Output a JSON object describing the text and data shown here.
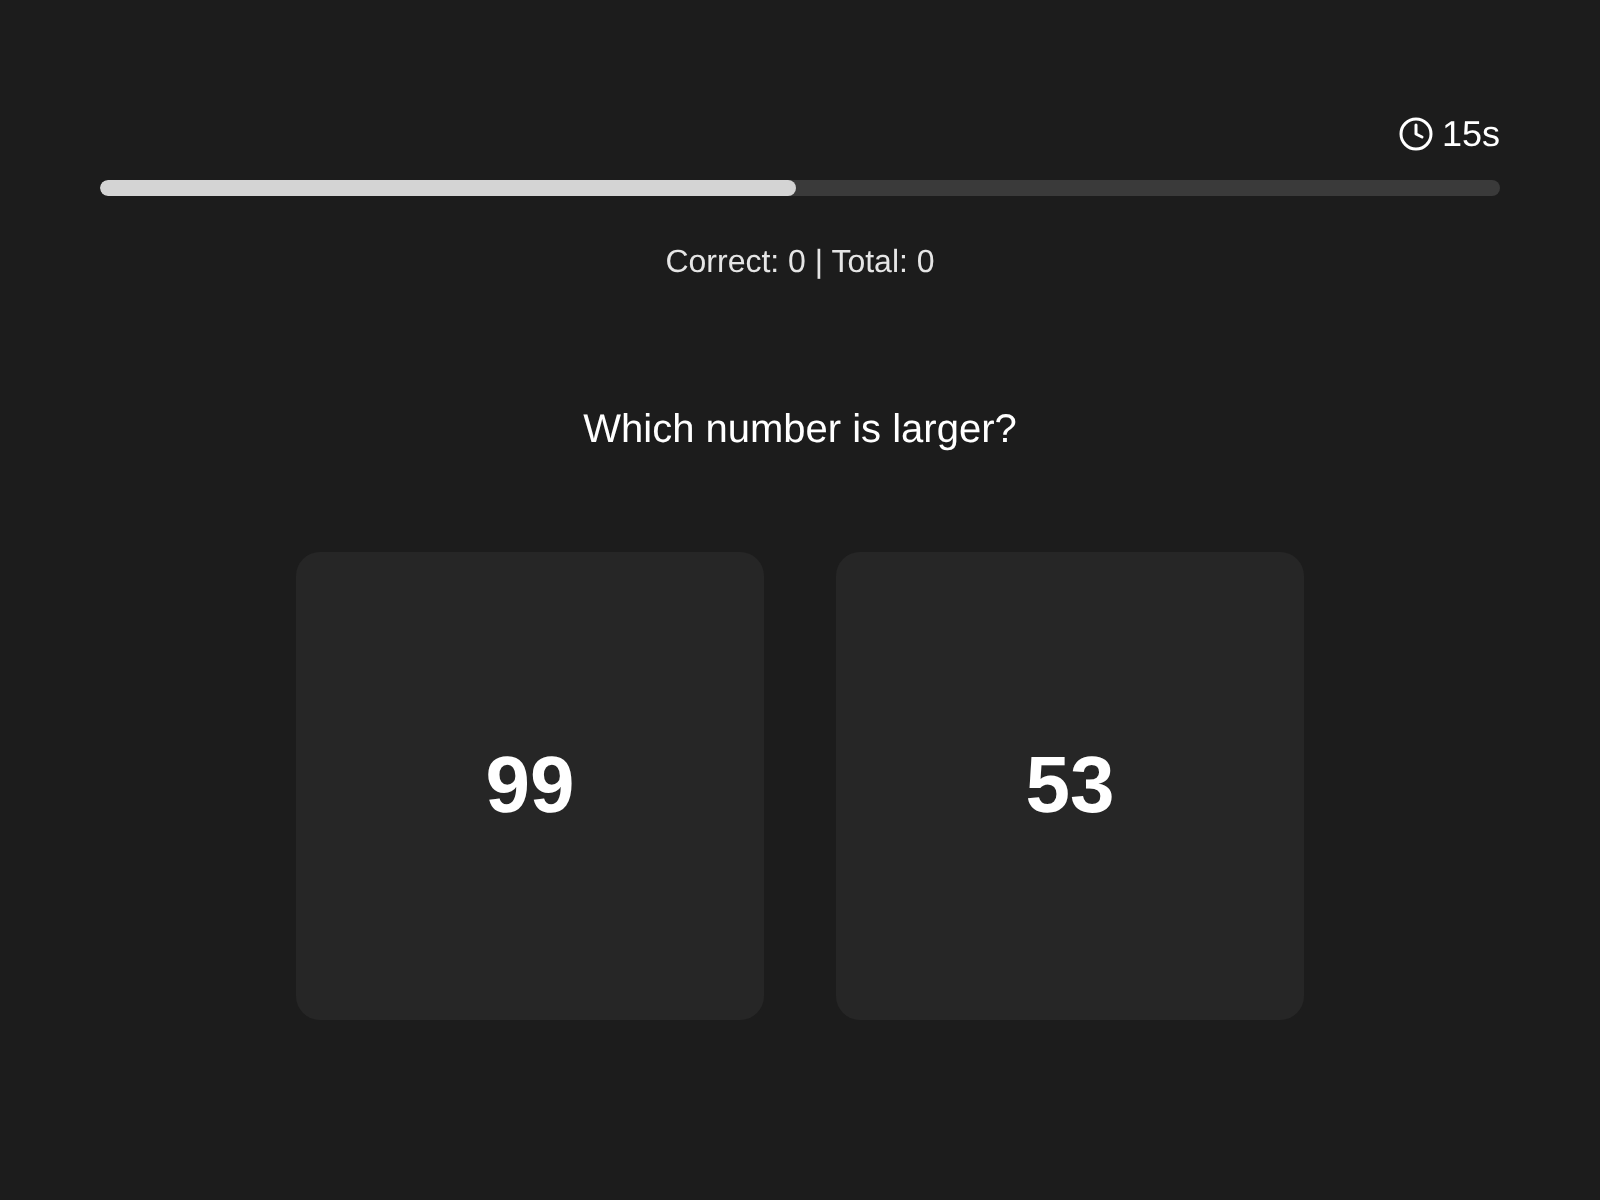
{
  "timer": {
    "text": "15s",
    "level": 0.497
  },
  "score": "Correct: 0 | Total: 0",
  "question": "Which number is larger?",
  "options": [
    {
      "text": "99"
    },
    {
      "text": "53"
    }
  ]
}
